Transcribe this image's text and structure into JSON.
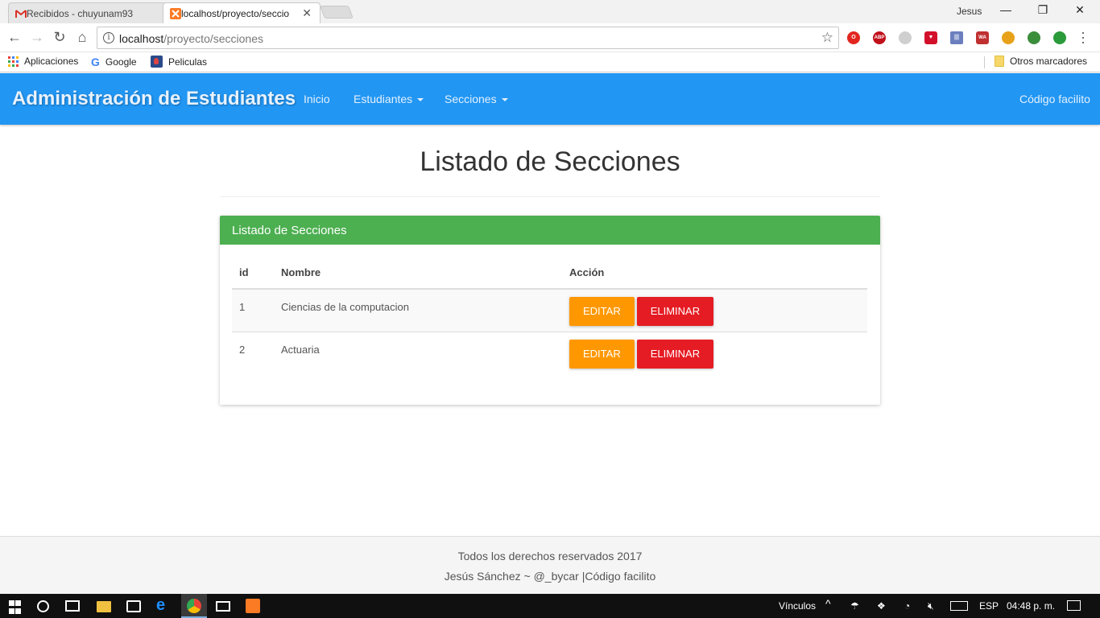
{
  "browser": {
    "tabs": [
      {
        "title": "Recibidos - chuyunam93",
        "favicon": "gmail-icon",
        "active": false
      },
      {
        "title": "localhost/proyecto/seccio",
        "favicon": "xampp-icon",
        "active": true
      }
    ],
    "user": "Jesus",
    "url_host": "localhost",
    "url_path": "/proyecto/secciones",
    "bookmarks": {
      "apps": "Aplicaciones",
      "google": "Google",
      "peliculas": "Peliculas",
      "other": "Otros marcadores"
    }
  },
  "navbar": {
    "brand": "Administración de Estudiantes",
    "links": {
      "inicio": "Inicio",
      "estudiantes": "Estudiantes",
      "secciones": "Secciones",
      "codigo": "Código facilito"
    },
    "color": "#2196f3"
  },
  "main": {
    "title": "Listado de Secciones",
    "panel": {
      "heading": "Listado de Secciones",
      "color": "#4caf50",
      "columns": {
        "id": "id",
        "nombre": "Nombre",
        "accion": "Acción"
      },
      "rows": [
        {
          "id": "1",
          "nombre": "Ciencias de la computacion",
          "edit": "EDITAR",
          "delete": "ELIMINAR"
        },
        {
          "id": "2",
          "nombre": "Actuaria",
          "edit": "EDITAR",
          "delete": "ELIMINAR"
        }
      ]
    }
  },
  "footer": {
    "line1": "Todos los derechos reservados 2017",
    "line2": "Jesús Sánchez ~ @_bycar |Código facilito"
  },
  "taskbar": {
    "links": "Vínculos",
    "lang": "ESP",
    "time": "04:48 p. m."
  },
  "colors": {
    "edit_button": "#ff9800",
    "delete_button": "#e51c23"
  }
}
